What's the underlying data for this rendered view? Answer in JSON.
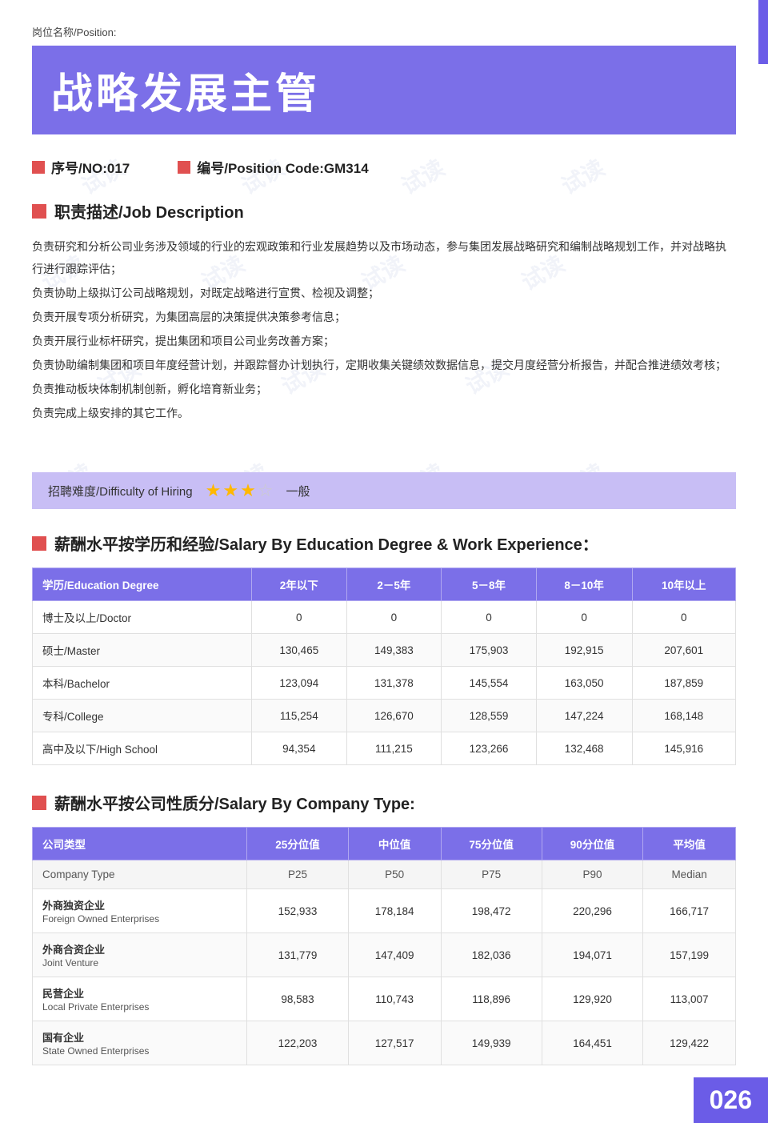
{
  "page": {
    "position_label": "岗位名称/Position:",
    "title": "战略发展主管",
    "no_label": "序号/NO:017",
    "code_label": "编号/Position Code:GM314",
    "job_desc_title": "职责描述/Job Description",
    "job_description": [
      "负责研究和分析公司业务涉及领域的行业的宏观政策和行业发展趋势以及市场动态，参与集团发展战略研究和编制战略规划工作，并对战略执行进行跟踪评估；",
      "负责协助上级拟订公司战略规划，对既定战略进行宣贯、检视及调整；",
      "负责开展专项分析研究，为集团高层的决策提供决策参考信息；",
      "负责开展行业标杆研究，提出集团和项目公司业务改善方案；",
      "负责协助编制集团和项目年度经营计划，并跟踪督办计划执行，定期收集关键绩效数据信息，提交月度经营分析报告，并配合推进绩效考核；",
      "负责推动板块体制机制创新，孵化培育新业务；",
      "负责完成上级安排的其它工作。"
    ],
    "difficulty_title": "招聘难度/Difficulty of Hiring",
    "difficulty_stars": [
      true,
      true,
      true,
      false
    ],
    "difficulty_desc": "一般",
    "salary_edu_title": "薪酬水平按学历和经验/Salary By Education Degree & Work Experience：",
    "salary_edu_headers": [
      "学历/Education Degree",
      "2年以下",
      "2－5年",
      "5－8年",
      "8－10年",
      "10年以上"
    ],
    "salary_edu_rows": [
      {
        "degree": "博士及以上/Doctor",
        "values": [
          0,
          0,
          0,
          0,
          0
        ]
      },
      {
        "degree": "硕士/Master",
        "values": [
          130465,
          149383,
          175903,
          192915,
          207601
        ]
      },
      {
        "degree": "本科/Bachelor",
        "values": [
          123094,
          131378,
          145554,
          163050,
          187859
        ]
      },
      {
        "degree": "专科/College",
        "values": [
          115254,
          126670,
          128559,
          147224,
          168148
        ]
      },
      {
        "degree": "高中及以下/High School",
        "values": [
          94354,
          111215,
          123266,
          132468,
          145916
        ]
      }
    ],
    "salary_company_title": "薪酬水平按公司性质分/Salary By Company Type:",
    "salary_company_headers": [
      "公司类型",
      "25分位值",
      "中位值",
      "75分位值",
      "90分位值",
      "平均值"
    ],
    "salary_company_subheaders": [
      "Company Type",
      "P25",
      "P50",
      "P75",
      "P90",
      "Median"
    ],
    "salary_company_rows": [
      {
        "cn": "外商独资企业",
        "en": "Foreign Owned Enterprises",
        "values": [
          152933,
          178184,
          198472,
          220296,
          166717
        ]
      },
      {
        "cn": "外商合资企业",
        "en": "Joint Venture",
        "values": [
          131779,
          147409,
          182036,
          194071,
          157199
        ]
      },
      {
        "cn": "民营企业",
        "en": "Local Private Enterprises",
        "values": [
          98583,
          110743,
          118896,
          129920,
          113007
        ]
      },
      {
        "cn": "国有企业",
        "en": "State Owned Enterprises",
        "values": [
          122203,
          127517,
          149939,
          164451,
          129422
        ]
      }
    ],
    "page_number": "026"
  }
}
